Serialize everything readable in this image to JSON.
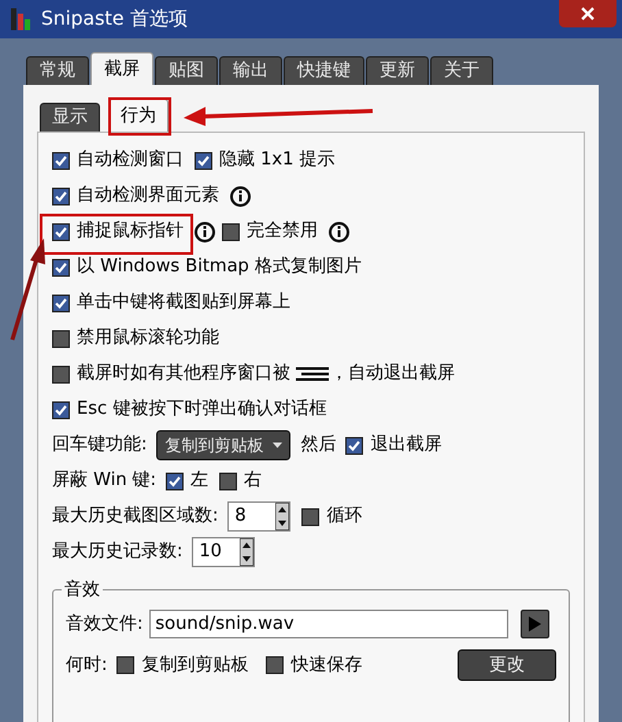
{
  "window": {
    "title": "Snipaste 首选项"
  },
  "tabs": [
    {
      "label": "常规",
      "selected": false
    },
    {
      "label": "截屏",
      "selected": true
    },
    {
      "label": "贴图",
      "selected": false
    },
    {
      "label": "输出",
      "selected": false
    },
    {
      "label": "快捷键",
      "selected": false
    },
    {
      "label": "更新",
      "selected": false
    },
    {
      "label": "关于",
      "selected": false
    }
  ],
  "subtabs": [
    {
      "label": "显示",
      "selected": false
    },
    {
      "label": "行为",
      "selected": true
    }
  ],
  "rows": [
    [
      {
        "kind": "check",
        "label": "自动检测窗口",
        "checked": true
      },
      {
        "kind": "check",
        "label": "隐藏 1x1 提示",
        "checked": true
      }
    ],
    [
      {
        "kind": "check",
        "label": "自动检测界面元素",
        "checked": true
      },
      {
        "kind": "info"
      }
    ],
    [
      {
        "kind": "check",
        "label": "捕捉鼠标指针",
        "checked": true
      },
      {
        "kind": "info"
      },
      {
        "kind": "check",
        "label": "完全禁用",
        "checked": false
      },
      {
        "kind": "info"
      }
    ],
    [
      {
        "kind": "check",
        "label": "以 Windows Bitmap 格式复制图片",
        "checked": true
      }
    ],
    [
      {
        "kind": "check",
        "label": "单击中键将截图贴到屏幕上",
        "checked": true
      }
    ],
    [
      {
        "kind": "check",
        "label": "禁用鼠标滚轮功能",
        "checked": false
      }
    ],
    [
      {
        "kind": "check",
        "label": "截屏时如有其他程序窗口被",
        "checked": false
      },
      {
        "kind": "bars"
      },
      {
        "kind": "text",
        "text": "，自动退出截屏"
      }
    ],
    [
      {
        "kind": "check",
        "label": "Esc 键被按下时弹出确认对话框",
        "checked": true
      }
    ],
    [
      {
        "kind": "text",
        "text": "回车键功能:"
      },
      {
        "kind": "dropdown",
        "value": "复制到剪贴板"
      },
      {
        "kind": "text",
        "text": "然后"
      },
      {
        "kind": "check",
        "label": "退出截屏",
        "checked": true
      }
    ],
    [
      {
        "kind": "text",
        "text": "屏蔽 Win 键:"
      },
      {
        "kind": "check",
        "label": "左",
        "checked": true
      },
      {
        "kind": "check",
        "label": "右",
        "checked": false
      }
    ],
    [
      {
        "kind": "text",
        "text": "最大历史截图区域数:"
      },
      {
        "kind": "spin",
        "value": "8"
      },
      {
        "kind": "check",
        "label": "循环",
        "checked": false
      }
    ],
    [
      {
        "kind": "text",
        "text": "最大历史记录数:"
      },
      {
        "kind": "spin",
        "value": "10"
      }
    ]
  ],
  "sound": {
    "title": "音效",
    "file_label": "音效文件:",
    "file": "sound/snip.wav",
    "when_label": "何时:",
    "options": [
      {
        "label": "复制到剪贴板",
        "checked": false
      },
      {
        "label": "快速保存",
        "checked": false
      }
    ],
    "button": "更改"
  }
}
